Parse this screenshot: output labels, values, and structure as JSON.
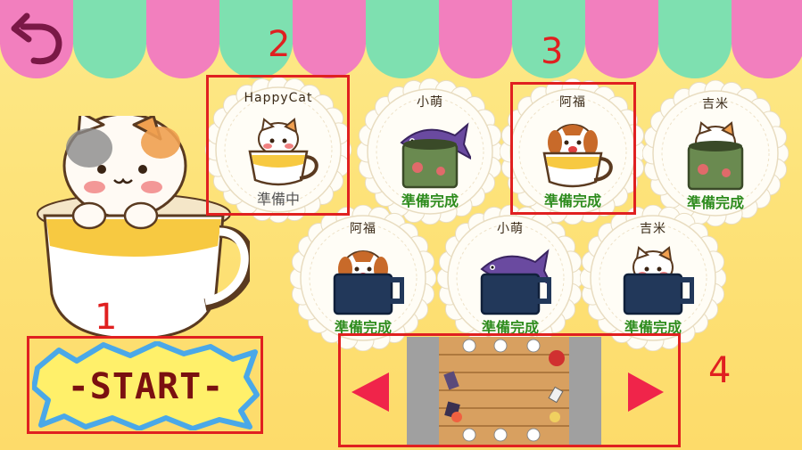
{
  "back_button": {
    "icon": "back-arrow-icon"
  },
  "colors": {
    "awning_pink": "#f27fbe",
    "awning_mint": "#7ee0b0",
    "annotation": "#e02020",
    "ready_green": "#2e8c1e"
  },
  "annotations": [
    "1",
    "2",
    "3",
    "4"
  ],
  "characters": [
    {
      "name": "HappyCat",
      "status": "準備中",
      "cup": "white-teacup",
      "pet": "cat"
    },
    {
      "name": "小萌",
      "status": "準備完成",
      "cup": "green-can",
      "pet": "fish"
    },
    {
      "name": "阿福",
      "status": "準備完成",
      "cup": "white-teacup",
      "pet": "dog"
    },
    {
      "name": "吉米",
      "status": "準備完成",
      "cup": "green-can",
      "pet": "cat"
    },
    {
      "name": "阿福",
      "status": "準備完成",
      "cup": "navy-mug",
      "pet": "dog"
    },
    {
      "name": "小萌",
      "status": "準備完成",
      "cup": "navy-mug",
      "pet": "fish"
    },
    {
      "name": "吉米",
      "status": "準備完成",
      "cup": "navy-mug",
      "pet": "cat"
    }
  ],
  "start_button": {
    "label": "-START-"
  },
  "table_selector": {
    "prev_icon": "triangle-left-icon",
    "next_icon": "triangle-right-icon"
  }
}
